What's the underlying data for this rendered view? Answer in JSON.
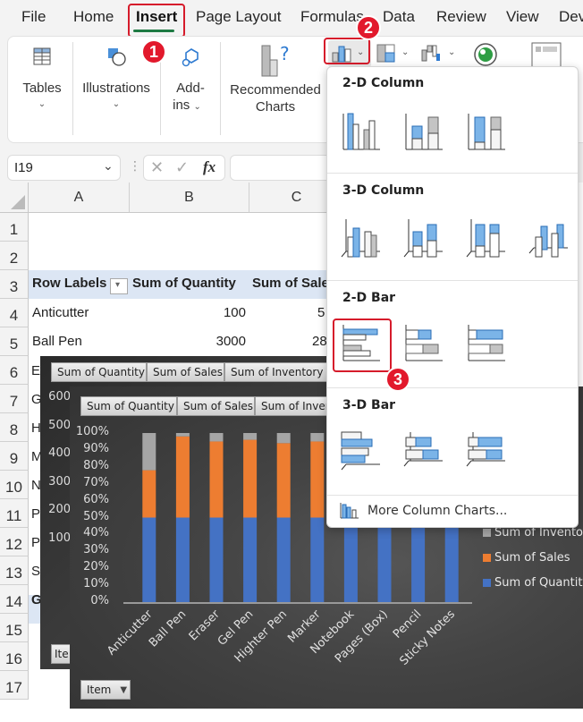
{
  "menu": {
    "tabs": [
      {
        "label": "File",
        "active": false
      },
      {
        "label": "Home",
        "active": false
      },
      {
        "label": "Insert",
        "active": true
      },
      {
        "label": "Page Layout",
        "active": false
      },
      {
        "label": "Formulas",
        "active": false
      },
      {
        "label": "Data",
        "active": false
      },
      {
        "label": "Review",
        "active": false
      },
      {
        "label": "View",
        "active": false
      },
      {
        "label": "Dev",
        "active": false
      }
    ]
  },
  "ribbon": {
    "tables": "Tables",
    "illustrations": "Illustrations",
    "addins_1": "Add-",
    "addins_2": "ins",
    "recommended_1": "Recommended",
    "recommended_2": "Charts"
  },
  "steps": {
    "one": "1",
    "two": "2",
    "three": "3"
  },
  "formula_bar": {
    "name_box": "I19",
    "cancel": "✕",
    "enter": "✓",
    "fx": "fx",
    "formula": ""
  },
  "columns": [
    "A",
    "B",
    "C"
  ],
  "rows": [
    "1",
    "2",
    "3",
    "4",
    "5",
    "6",
    "7",
    "8",
    "9",
    "10",
    "11",
    "12",
    "13",
    "14",
    "15",
    "16",
    "17"
  ],
  "pivot": {
    "header": {
      "row_labels": "Row Labels",
      "sum_qty": "Sum of Quantity",
      "sum_sales": "Sum of Sale"
    },
    "rows": [
      {
        "label": "Anticutter",
        "qty": "100",
        "sales": "5"
      },
      {
        "label": "Ball Pen",
        "qty": "3000",
        "sales": "28"
      }
    ],
    "clipped_labels": [
      "E",
      "G",
      "H",
      "M",
      "N",
      "P",
      "P",
      "St",
      "G"
    ]
  },
  "chart_back": {
    "fields": [
      "Sum of Quantity",
      "Sum of Sales",
      "Sum of Inventory"
    ],
    "yticks": [
      "600",
      "500",
      "400",
      "300",
      "200",
      "100"
    ],
    "item_button": "Ite"
  },
  "chart_data": {
    "type": "bar",
    "stacked": "100%",
    "categories": [
      "Anticutter",
      "Ball Pen",
      "Eraser",
      "Gel Pen",
      "Highter Pen",
      "Marker",
      "Notebook",
      "Pages (Box)",
      "Pencil",
      "Sticky Notes"
    ],
    "series": [
      {
        "name": "Sum of Quantity",
        "color": "#4472c4",
        "values": [
          50,
          50,
          50,
          50,
          50,
          50,
          50,
          50,
          50,
          50
        ]
      },
      {
        "name": "Sum of Sales",
        "color": "#ed7d31",
        "values": [
          28,
          48,
          45,
          46,
          44,
          45,
          null,
          null,
          null,
          null
        ]
      },
      {
        "name": "Sum of Inventory",
        "color": "#a5a5a5",
        "values": [
          22,
          2,
          5,
          4,
          6,
          5,
          null,
          null,
          null,
          null
        ]
      }
    ],
    "yticks": [
      "0%",
      "10%",
      "20%",
      "30%",
      "40%",
      "50%",
      "60%",
      "70%",
      "80%",
      "90%",
      "100%"
    ],
    "ylim": [
      0,
      100
    ],
    "legend": [
      "Sum of Inventor",
      "Sum of Sales",
      "Sum of Quantity"
    ],
    "legend_position": "right",
    "field_buttons": [
      "Sum of Quantity",
      "Sum of Sales",
      "Sum of Inver"
    ],
    "item_button": "Item"
  },
  "dropdown": {
    "sections": [
      "2-D Column",
      "3-D Column",
      "2-D Bar",
      "3-D Bar"
    ],
    "more": "More Column Charts..."
  }
}
